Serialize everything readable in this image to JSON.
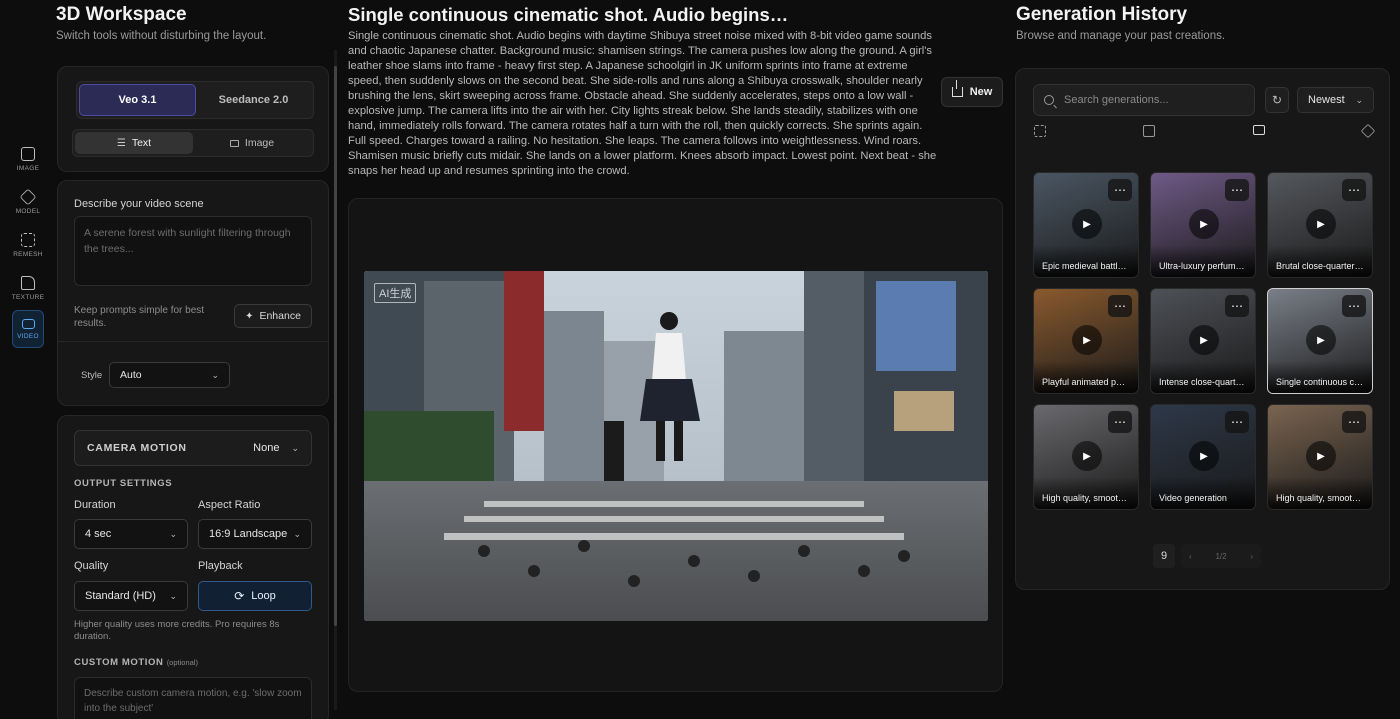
{
  "workspace": {
    "title": "3D Workspace",
    "subtitle": "Switch tools without disturbing the layout."
  },
  "rail": [
    {
      "label": "IMAGE",
      "icon": "image-icon"
    },
    {
      "label": "MODEL",
      "icon": "cube-icon"
    },
    {
      "label": "REMESH",
      "icon": "grid-icon"
    },
    {
      "label": "TEXTURE",
      "icon": "texture-icon"
    },
    {
      "label": "VIDEO",
      "icon": "video-icon",
      "active": true
    }
  ],
  "models": {
    "primary": "Veo 3.1",
    "secondary": "Seedance 2.0"
  },
  "modes": {
    "text": "Text",
    "image": "Image"
  },
  "prompt": {
    "label": "Describe your video scene",
    "placeholder": "A serene forest with sunlight filtering through the trees...",
    "hint": "Keep prompts simple for best results.",
    "enhance": "Enhance"
  },
  "style": {
    "label": "Style",
    "value": "Auto"
  },
  "camera": {
    "label": "CAMERA MOTION",
    "value": "None"
  },
  "output": {
    "heading": "OUTPUT SETTINGS",
    "duration_label": "Duration",
    "duration": "4 sec",
    "aspect_label": "Aspect Ratio",
    "aspect": "16:9 Landscape",
    "quality_label": "Quality",
    "quality": "Standard (HD)",
    "playback_label": "Playback",
    "playback": "Loop",
    "note": "Higher quality uses more credits. Pro requires 8s duration."
  },
  "custom_motion": {
    "heading": "CUSTOM MOTION",
    "optional": "(optional)",
    "placeholder": "Describe custom camera motion, e.g. 'slow zoom into the subject'"
  },
  "center": {
    "title": "Single continuous cinematic shot. Audio begins…",
    "description": "Single continuous cinematic shot. Audio begins with daytime Shibuya street noise mixed with 8-bit video game sounds and chaotic Japanese chatter. Background music: shamisen strings. The camera pushes low along the ground. A girl's leather shoe slams into frame - heavy first step. A Japanese schoolgirl in JK uniform sprints into frame at extreme speed, then suddenly slows on the second beat. She side-rolls and runs along a Shibuya crosswalk, shoulder nearly brushing the lens, skirt sweeping across frame. Obstacle ahead. She suddenly accelerates, steps onto a low wall - explosive jump. The camera lifts into the air with her. City lights streak below. She lands steadily, stabilizes with one hand, immediately rolls forward. The camera rotates half a turn with the roll, then quickly corrects. She sprints again. Full speed. Charges toward a railing. No hesitation. She leaps. The camera follows into weightlessness. Wind roars. Shamisen music briefly cuts midair. She lands on a lower platform. Knees absorb impact. Lowest point. Next beat - she snaps her head up and resumes sprinting into the crowd.",
    "new_button": "New",
    "watermark": "AI生成"
  },
  "history": {
    "title": "Generation History",
    "subtitle": "Browse and manage your past creations.",
    "search_placeholder": "Search generations...",
    "sort": "Newest",
    "items": [
      {
        "caption": "Epic medieval battl…",
        "color": "#4a5663"
      },
      {
        "caption": "Ultra-luxury perfum…",
        "color": "#6f5a86"
      },
      {
        "caption": "Brutal close-quarter…",
        "color": "#55585d"
      },
      {
        "caption": "Playful animated pe…",
        "color": "#8a5a2e"
      },
      {
        "caption": "Intense close-quart…",
        "color": "#4e5157"
      },
      {
        "caption": "Single continuous c…",
        "color": "#7a7f88"
      },
      {
        "caption": "High quality, smoot…",
        "color": "#6a6a6e"
      },
      {
        "caption": "Video generation",
        "color": "#2d3848"
      },
      {
        "caption": "High quality, smoot…",
        "color": "#7a6450"
      }
    ],
    "count": "9",
    "page": "1/2"
  }
}
